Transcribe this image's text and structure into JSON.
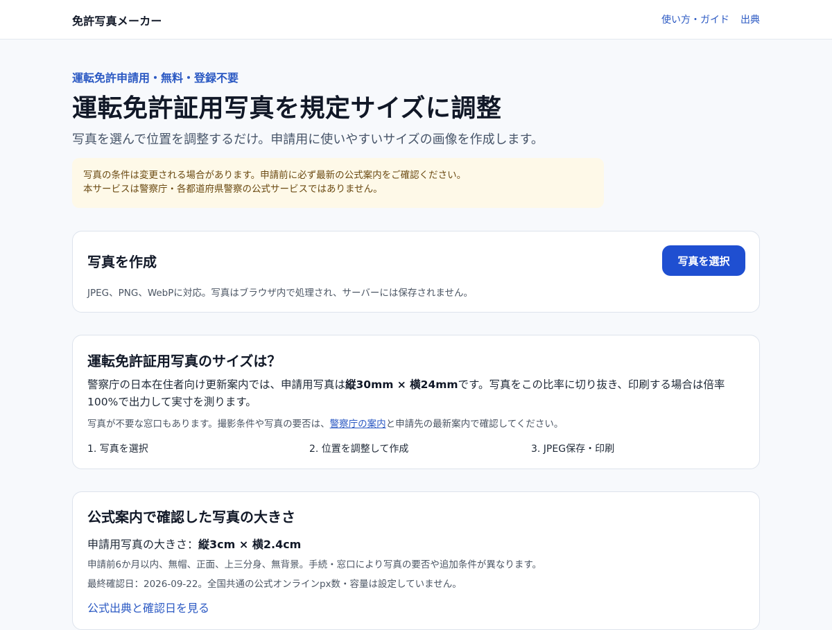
{
  "header": {
    "brand": "免許写真メーカー",
    "nav": [
      "使い方・ガイド",
      "出典"
    ]
  },
  "hero": {
    "eyebrow": "運転免許申請用・無料・登録不要",
    "title": "運転免許証用写真を規定サイズに調整",
    "subtitle": "写真を選んで位置を調整するだけ。申請用に使いやすいサイズの画像を作成します。"
  },
  "notice": {
    "line1": "写真の条件は変更される場合があります。申請前に必ず最新の公式案内をご確認ください。",
    "line2": "本サービスは警察庁・各都道府県警察の公式サービスではありません。"
  },
  "create_card": {
    "title": "写真を作成",
    "button": "写真を選択",
    "note": "JPEG、PNG、WebPに対応。写真はブラウザ内で処理され、サーバーには保存されません。"
  },
  "size_card": {
    "title": "運転免許証用写真のサイズは？",
    "text_before": "警察庁の日本在住者向け更新案内では、申請用写真は",
    "text_bold": "縦30mm × 横24mm",
    "text_after": "です。写真をこの比率に切り抜き、印刷する場合は倍率100%で出力して実寸を測ります。",
    "note_before": "写真が不要な窓口もあります。撮影条件や写真の要否は、",
    "note_link": "警察庁の案内",
    "note_after": "と申請先の最新案内で確認してください。",
    "steps": [
      "1. 写真を選択",
      "2. 位置を調整して作成",
      "3. JPEG保存・印刷"
    ]
  },
  "official_card": {
    "title": "公式案内で確認した写真の大きさ",
    "size_label": "申請用写真の大きさ：",
    "size_value": "縦3cm × 横2.4cm",
    "conditions": "申請前6か月以内、無帽、正面、上三分身、無背景。手続・窓口により写真の要否や追加条件が異なります。",
    "last_checked": "最終確認日：2026-09-22。全国共通の公式オンラインpx数・容量は設定していません。",
    "source_link": "公式出典と確認日を見る"
  }
}
